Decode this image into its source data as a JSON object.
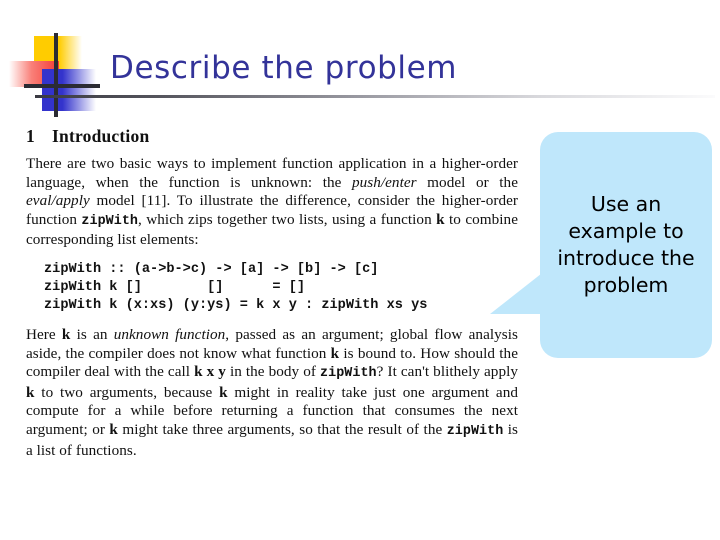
{
  "slide": {
    "title": "Describe the problem",
    "title_color": "#333399",
    "rule_color": "#3a3a42",
    "background": "#ffffff"
  },
  "logo": {
    "name": "decorative-squares-logo",
    "yellow": "#FFCC00",
    "red": "#F43A34",
    "blue": "#3333CC",
    "bar": "#2b2b33"
  },
  "paper": {
    "section_number": "1",
    "section_title": "Introduction",
    "paragraph1": {
      "runs": [
        {
          "text": "There are two basic ways to implement function application in a higher-order language, when the function is unknown: the ",
          "style": "normal"
        },
        {
          "text": "push/enter",
          "style": "italic"
        },
        {
          "text": " model or the ",
          "style": "normal"
        },
        {
          "text": "eval/apply",
          "style": "italic"
        },
        {
          "text": " model [11]. To illustrate the difference, consider the higher-order function ",
          "style": "normal"
        },
        {
          "text": "zipWith",
          "style": "mono"
        },
        {
          "text": ", which zips together two lists, using a function ",
          "style": "normal"
        },
        {
          "text": "k",
          "style": "bold"
        },
        {
          "text": " to combine corresponding list elements:",
          "style": "normal"
        }
      ],
      "plain": "There are two basic ways to implement function application in a higher-order language, when the function is unknown: the push/enter model or the eval/apply model [11]. To illustrate the difference, consider the higher-order function zipWith, which zips together two lists, using a function k to combine corresponding list elements:"
    },
    "code": "zipWith :: (a->b->c) -> [a] -> [b] -> [c]\nzipWith k []        []      = []\nzipWith k (x:xs) (y:ys) = k x y : zipWith xs ys",
    "paragraph2": {
      "runs": [
        {
          "text": "Here ",
          "style": "normal"
        },
        {
          "text": "k",
          "style": "bold"
        },
        {
          "text": " is an ",
          "style": "normal"
        },
        {
          "text": "unknown function",
          "style": "italic"
        },
        {
          "text": ", passed as an argument; global flow analysis aside, the compiler does not know what function ",
          "style": "normal"
        },
        {
          "text": "k",
          "style": "bold"
        },
        {
          "text": " is bound to. How should the compiler deal with the call ",
          "style": "normal"
        },
        {
          "text": "k x y",
          "style": "bold"
        },
        {
          "text": " in the body of ",
          "style": "normal"
        },
        {
          "text": "zipWith",
          "style": "mono"
        },
        {
          "text": "? It can't blithely apply ",
          "style": "normal"
        },
        {
          "text": "k",
          "style": "bold"
        },
        {
          "text": " to two arguments, because ",
          "style": "normal"
        },
        {
          "text": "k",
          "style": "bold"
        },
        {
          "text": " might in reality take just one argument and compute for a while before returning a function that consumes the next argument; or ",
          "style": "normal"
        },
        {
          "text": "k",
          "style": "bold"
        },
        {
          "text": " might take three arguments, so that the result of the ",
          "style": "normal"
        },
        {
          "text": "zipWith",
          "style": "mono"
        },
        {
          "text": " is a list of functions.",
          "style": "normal"
        }
      ],
      "plain": "Here k is an unknown function, passed as an argument; global flow analysis aside, the compiler does not know what function k is bound to. How should the compiler deal with the call k x y in the body of zipWith? It can't blithely apply k to two arguments, because k might in reality take just one argument and compute for a while before returning a function that consumes the next argument; or k might take three arguments, so that the result of the zipWith is a list of functions."
    }
  },
  "callout": {
    "text": "Use an example to introduce the problem",
    "fill": "#BFE7FB",
    "text_color": "#000000"
  }
}
